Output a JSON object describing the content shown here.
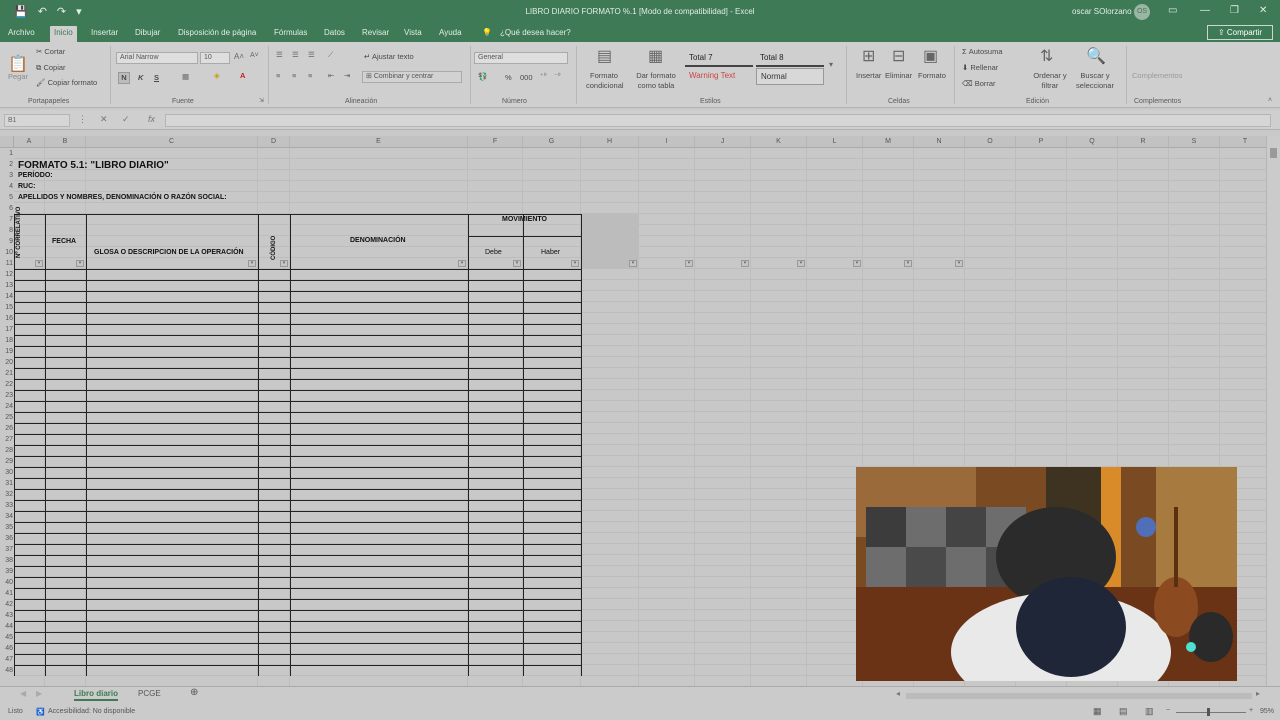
{
  "window": {
    "title": "LIBRO DIARIO FORMATO %.1 [Modo de compatibilidad] - Excel",
    "user": "oscar SOlorzano",
    "avatar": "OS",
    "search_tell": "¿Qué desea hacer?",
    "share": "Compartir"
  },
  "menu": [
    "Archivo",
    "Inicio",
    "Insertar",
    "Dibujar",
    "Disposición de página",
    "Fórmulas",
    "Datos",
    "Revisar",
    "Vista",
    "Ayuda"
  ],
  "ribbon": {
    "clipboard": {
      "group": "Portapapeles",
      "paste": "Pegar",
      "cut": "Cortar",
      "copy": "Copiar",
      "format_painter": "Copiar formato"
    },
    "font": {
      "group": "Fuente",
      "name": "Arial Narrow",
      "size": "10",
      "bold": "N",
      "italic": "K",
      "underline": "S"
    },
    "alignment": {
      "group": "Alineación",
      "wrap": "Ajustar texto",
      "merge": "Combinar y centrar"
    },
    "number": {
      "group": "Número",
      "format": "General",
      "percent": "%",
      "thousands": "000"
    },
    "styles": {
      "group": "Estilos",
      "conditional": "Formato condicional",
      "as_table": "Dar formato como tabla",
      "total7": "Total 7",
      "total8": "Total 8",
      "warning": "Warning Text",
      "normal": "Normal"
    },
    "cells": {
      "group": "Celdas",
      "insert": "Insertar",
      "delete": "Eliminar",
      "format": "Formato"
    },
    "editing": {
      "group": "Edición",
      "autosum": "Autosuma",
      "fill": "Rellenar",
      "clear": "Borrar",
      "sort": "Ordenar y filtrar",
      "find": "Buscar y seleccionar"
    },
    "addins": {
      "group": "Complementos",
      "label": "Complementos"
    }
  },
  "formula_bar": {
    "name_box": "B1",
    "fx": "fx",
    "value": ""
  },
  "columns": [
    "A",
    "B",
    "C",
    "D",
    "E",
    "F",
    "G",
    "H",
    "I",
    "J",
    "K",
    "L",
    "M",
    "N",
    "O",
    "P",
    "Q",
    "R",
    "S",
    "T"
  ],
  "sheet": {
    "title": "FORMATO 5.1: \"LIBRO DIARIO\"",
    "periodo": "PERÍODO:",
    "ruc": "RUC:",
    "apellidos": "APELLIDOS Y NOMBRES, DENOMINACIÓN O RAZÓN SOCIAL:",
    "h_correlativo": "Nº CORRELATIVO",
    "h_fecha": "FECHA",
    "h_glosa": "GLOSA O DESCRIPCION DE LA OPERACIÓN",
    "h_codigo": "CÓDIGO",
    "h_denominacion": "DENOMINACIÓN",
    "h_movimiento": "MOVIMIENTO",
    "h_debe": "Debe",
    "h_haber": "Haber"
  },
  "tabs": {
    "sheet1": "Libro diario",
    "sheet2": "PCGE"
  },
  "status": {
    "ready": "Listo",
    "accessibility": "Accesibilidad: No disponible",
    "zoom": "95%"
  }
}
